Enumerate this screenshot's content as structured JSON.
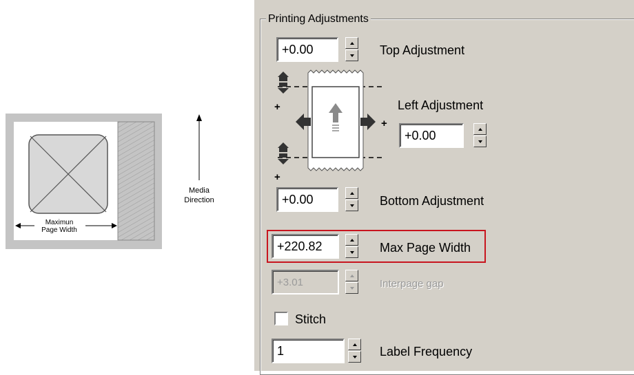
{
  "diagram": {
    "media_direction_line1": "Media",
    "media_direction_line2": "Direction",
    "max_width_line1": "Maximun",
    "max_width_line2": "Page Width"
  },
  "panel": {
    "group_title": "Printing Adjustments",
    "top_adjustment": {
      "value": "+0.00",
      "label": "Top Adjustment"
    },
    "left_adjustment": {
      "value": "+0.00",
      "label": "Left Adjustment"
    },
    "bottom_adjustment": {
      "value": "+0.00",
      "label": "Bottom Adjustment"
    },
    "max_page_width": {
      "value": "+220.82",
      "label": "Max Page Width"
    },
    "interpage_gap": {
      "value": "+3.01",
      "label": "Interpage gap",
      "disabled": true
    },
    "stitch": {
      "label": "Stitch",
      "checked": false
    },
    "label_frequency": {
      "value": "1",
      "label": "Label Frequency"
    },
    "plus_sign": "+"
  },
  "colors": {
    "panel_bg": "#d4d0c8",
    "highlight_border": "#c8141e"
  }
}
